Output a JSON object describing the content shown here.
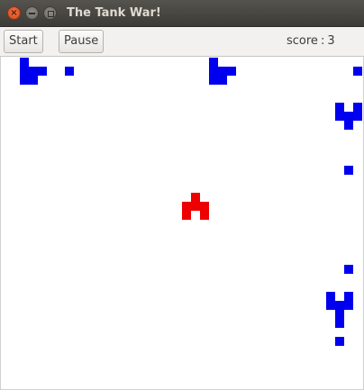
{
  "window": {
    "title": "The Tank War!",
    "controls": [
      "close-icon",
      "minimize-icon",
      "maximize-icon"
    ]
  },
  "toolbar": {
    "start_label": "Start",
    "pause_label": "Pause",
    "score_label": "score",
    "score_separator": ":",
    "score_value": "3"
  },
  "colors": {
    "enemy": "#0000ee",
    "player": "#ee0000",
    "field": "#ffffff",
    "titlebar": "#3c3b37",
    "toolbar": "#f2f1f0"
  },
  "game": {
    "player_tanks": 1,
    "enemy_tanks": 4,
    "bullets": 5
  }
}
